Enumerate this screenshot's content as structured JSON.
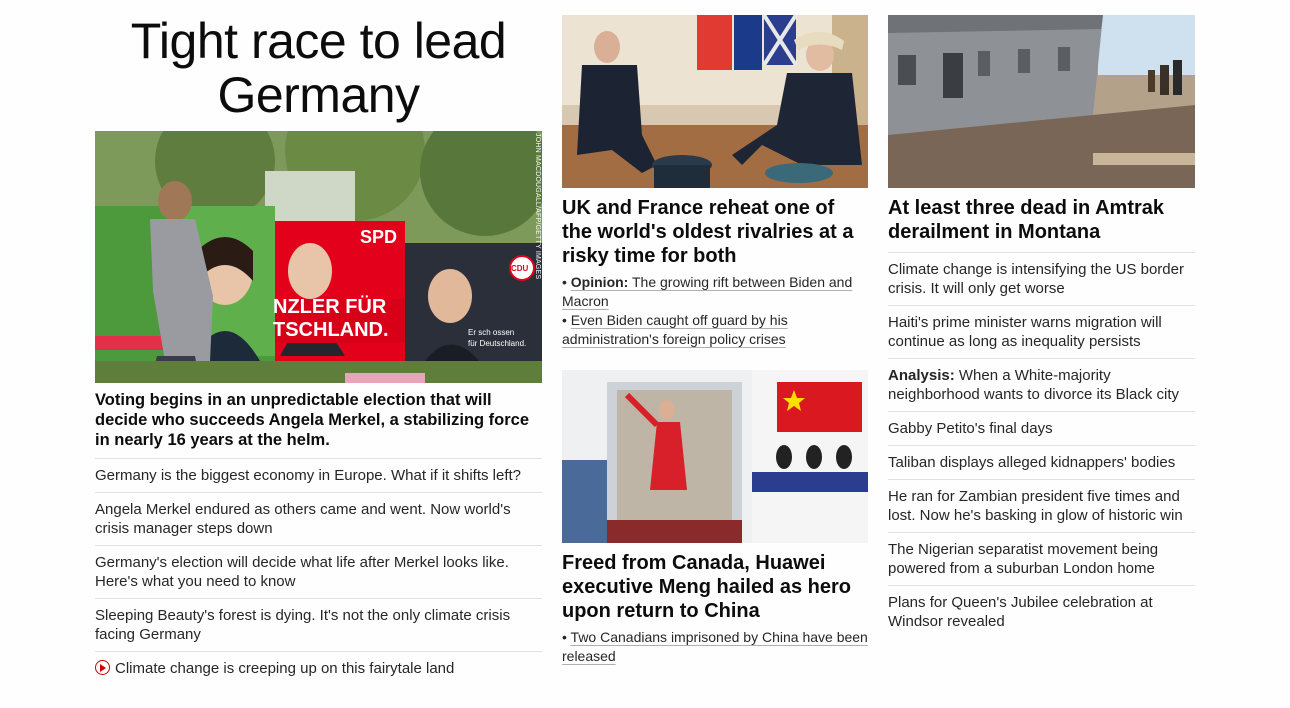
{
  "col1": {
    "title": "Tight race to lead Germany",
    "image": {
      "alt": "Election posters in Germany",
      "credit": "JOHN MACDOUGALL/AFP/GETTY IMAGES"
    },
    "poster": {
      "spd": "SPD",
      "slogan1": "NZLER FÜR",
      "slogan2": "TSCHLAND.",
      "cdu": "CDU",
      "cdu_slogan1": "Er sch ossen",
      "cdu_slogan2": "für Deutschland."
    },
    "lead": "Voting begins in an unpredictable election that will decide who succeeds Angela Merkel, a stabilizing force in nearly 16 years at the helm.",
    "links": [
      "Germany is the biggest economy in Europe. What if it shifts left?",
      "Angela Merkel endured as others came and went. Now world's crisis manager steps down",
      "Germany's election will decide what life after Merkel looks like. Here's what you need to know",
      "Sleeping Beauty's forest is dying. It's not the only climate crisis facing Germany"
    ],
    "video_link": "Climate change is creeping up on this fairytale land"
  },
  "col2": {
    "story1": {
      "image_alt": "Macron and Johnson seated",
      "headline": "UK and France reheat one of the world's oldest rivalries at a risky time for both",
      "sub1_prefix": "Opinion:",
      "sub1_text": " The growing rift between Biden and Macron",
      "sub2_text": "Even Biden caught off guard by his administration's foreign policy crises"
    },
    "story2": {
      "image_alt": "Meng Wanzhou waving from plane",
      "headline": "Freed from Canada, Huawei executive Meng hailed as hero upon return to China",
      "sub1_text": "Two Canadians imprisoned by China have been released"
    }
  },
  "col3": {
    "image_alt": "Derailed Amtrak train",
    "headline": "At least three dead in Amtrak derailment in Montana",
    "links": [
      {
        "prefix": "",
        "text": "Climate change is intensifying the US border crisis. It will only get worse"
      },
      {
        "prefix": "",
        "text": "Haiti's prime minister warns migration will continue as long as inequality persists"
      },
      {
        "prefix": "Analysis:",
        "text": " When a White-majority neighborhood wants to divorce its Black city"
      },
      {
        "prefix": "",
        "text": "Gabby Petito's final days"
      },
      {
        "prefix": "",
        "text": "Taliban displays alleged kidnappers' bodies"
      },
      {
        "prefix": "",
        "text": "He ran for Zambian president five times and lost. Now he's basking in glow of historic win"
      },
      {
        "prefix": "",
        "text": "The Nigerian separatist movement being powered from a suburban London home"
      },
      {
        "prefix": "",
        "text": "Plans for Queen's Jubilee celebration at Windsor revealed"
      }
    ]
  },
  "colors": {
    "accent_red": "#cc0000",
    "text": "#0c0c0c",
    "divider": "#e2e2e2"
  }
}
